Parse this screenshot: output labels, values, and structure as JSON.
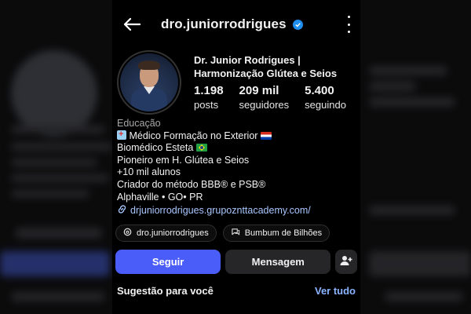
{
  "profile": {
    "username": "dro.juniorrodrigues",
    "display_name_line1": "Dr. Junior Rodrigues |",
    "display_name_line2": "Harmonização Glútea e Seios"
  },
  "stats": [
    {
      "value": "1.198",
      "label": "posts"
    },
    {
      "value": "209 mil",
      "label": "seguidores"
    },
    {
      "value": "5.400",
      "label": "seguindo"
    }
  ],
  "bio": {
    "category": "Educação",
    "lines": [
      "Médico Formação no Exterior",
      "Biomédico Esteta",
      "Pioneiro em H. Glútea e Seios",
      "+10 mil alunos",
      "Criador do método BBB® e PSB®",
      "Alphaville • GO• PR"
    ],
    "link": "drjuniorrodrigues.grupoznttacademy.com/"
  },
  "chips": [
    {
      "label": "dro.juniorrodrigues",
      "icon": "threads-icon"
    },
    {
      "label": "Bumbum de Bilhões",
      "icon": "channel-icon"
    }
  ],
  "actions": {
    "follow": "Seguir",
    "message": "Mensagem",
    "suggest_icon": "add-person-icon"
  },
  "suggestions": {
    "title": "Sugestão para você",
    "see_all": "Ver tudo"
  },
  "colors": {
    "accent": "#4a5df9",
    "verified": "#1f8ef1",
    "link": "#a9c6ff"
  }
}
